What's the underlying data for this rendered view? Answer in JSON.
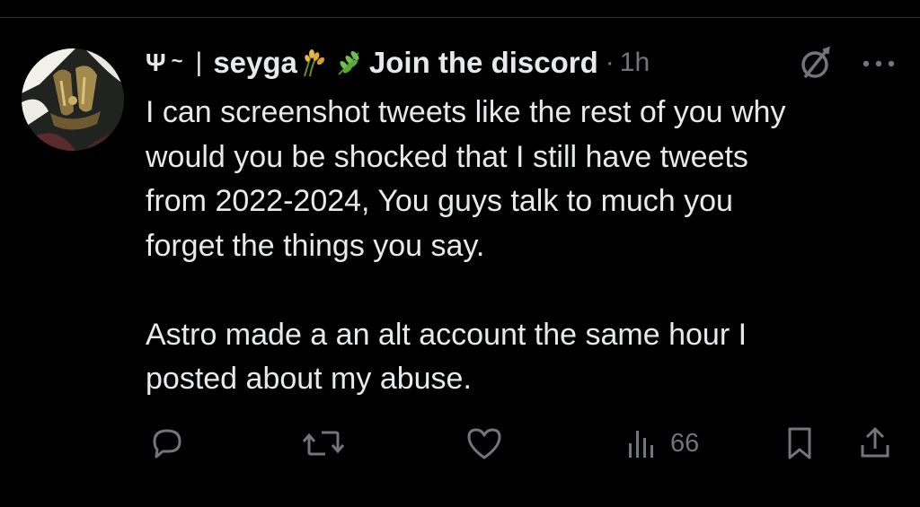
{
  "post": {
    "display_name": "seyga",
    "name_prefix_glyph": "Ψ",
    "name_prefix_mark": "~",
    "separator": "|",
    "bio_text": "Join the discord",
    "dot": "·",
    "time": "1h",
    "body": "I can screenshot tweets like the rest of you why\nwould you be shocked that I still have tweets\nfrom 2022-2024, You guys talk to much you\nforget the things you say.\n\nAstro made a an alt account the same hour I\nposted about my abuse.",
    "icons": {
      "emoji_1": "rice-sheaf-icon",
      "emoji_2": "herb-icon",
      "grok": "grok-icon",
      "more": "more-icon"
    }
  },
  "actions": {
    "views": "66",
    "icons": [
      "reply-icon",
      "repost-icon",
      "like-icon",
      "views-icon",
      "bookmark-icon",
      "share-icon"
    ]
  },
  "colors": {
    "background": "#000000",
    "text": "#e7e9ea",
    "muted": "#71767b",
    "divider": "#2f3336"
  }
}
